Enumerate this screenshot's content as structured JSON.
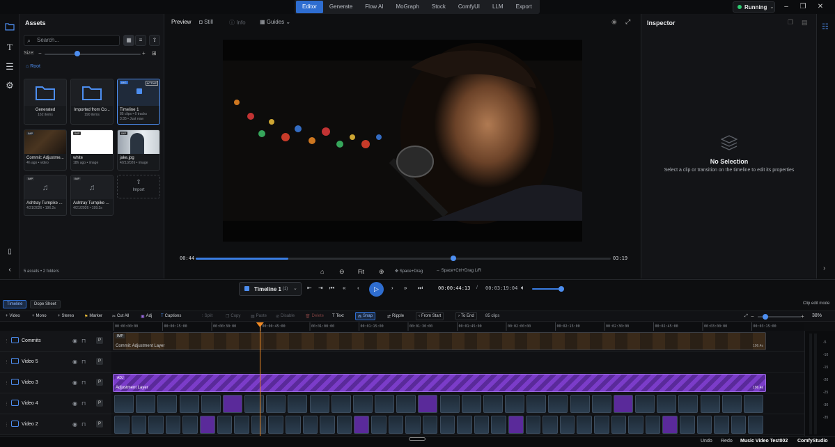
{
  "topbar": {
    "tabs": [
      "Editor",
      "Generate",
      "Flow AI",
      "MoGraph",
      "Stock",
      "ComfyUI",
      "LLM",
      "Export"
    ],
    "active_tab": "Editor",
    "status": "Running"
  },
  "assets": {
    "title": "Assets",
    "search_placeholder": "Search...",
    "size_label": "Size:",
    "breadcrumb": "Root",
    "footer": "5 assets • 2 folders",
    "items": [
      {
        "name": "Generated",
        "meta": "162 items",
        "kind": "folder"
      },
      {
        "name": "Imported from Co...",
        "meta": "190 items",
        "kind": "folder"
      },
      {
        "name": "Timeline 1",
        "meta": "85 clips • 6 tracks",
        "meta2": "3:35 • Just now",
        "kind": "timeline",
        "badge": "IMG",
        "active": "ACTIVE"
      },
      {
        "name": "Commit: Adjustme...",
        "meta": "4h ago • video",
        "kind": "video",
        "badge": "IMP"
      },
      {
        "name": "white",
        "meta": "18h ago • image",
        "kind": "white",
        "badge": "IMP"
      },
      {
        "name": "jake.jpg",
        "meta": "4/21/2026 • image",
        "kind": "photo",
        "badge": "IMP"
      },
      {
        "name": "Ashtray Turnpike ...",
        "meta": "4/21/2026 • 196.2s",
        "kind": "audio",
        "badge": "IMP"
      },
      {
        "name": "Ashtray Turnpike ...",
        "meta": "4/21/2026 • 199.2s",
        "kind": "audio",
        "badge": "IMP"
      }
    ],
    "import_label": "Import"
  },
  "preview": {
    "tabs": [
      "Preview",
      "Still",
      "Info",
      "Guides"
    ],
    "current_time": "00:44",
    "end_time": "03:19",
    "scrub_progress": 0.223,
    "fit_label": "Fit",
    "hint1": "Space+Drag",
    "hint2": "Space+Ctrl+Drag L/R"
  },
  "inspector": {
    "title": "Inspector",
    "empty_title": "No Selection",
    "empty_desc": "Select a clip or transition on the timeline to edit its properties"
  },
  "transport": {
    "timeline_name": "Timeline 1",
    "timeline_count": "(1)",
    "timecode": "00:00:44:13",
    "separator": "/",
    "duration": "00:03:19:04",
    "volume": 0.95
  },
  "timeline": {
    "tabs": [
      "Timeline",
      "Dope Sheet"
    ],
    "mode_label": "Clip edit mode",
    "tools": [
      "Video",
      "Mono",
      "Stereo",
      "Marker",
      "Cut All",
      "Adj",
      "Captions",
      "Split",
      "Copy",
      "Paste",
      "Disable",
      "Delete",
      "Text",
      "Snap",
      "Ripple",
      "From Start",
      "To End"
    ],
    "clip_count": "85 clips",
    "zoom": "38%",
    "ruler_labels": [
      "00:00:00:00",
      "00:00:15:00",
      "00:00:30:00",
      "00:00:45:00",
      "00:01:00:00",
      "00:01:15:00",
      "00:01:30:00",
      "00:01:45:00",
      "00:02:00:00",
      "00:02:15:00",
      "00:02:30:00",
      "00:02:45:00",
      "00:03:00:00",
      "00:03:15:00"
    ],
    "tracks": [
      {
        "name": "Commits",
        "clip_label": "Commit: Adjustment Layer",
        "clip_badge": "IMP",
        "duration": "196.4s"
      },
      {
        "name": "Video 5"
      },
      {
        "name": "Video 3",
        "clip_label": "Adjustment Layer",
        "clip_badge": "ADJ",
        "duration": "196.4s"
      },
      {
        "name": "Video 4"
      },
      {
        "name": "Video 2"
      }
    ],
    "meter_labels": [
      "-5",
      "-10",
      "-15",
      "-20",
      "-25",
      "-30",
      "-35"
    ],
    "playhead_fraction": 0.223
  },
  "status": {
    "undo": "Undo",
    "redo": "Redo",
    "project": "Music Video Test002",
    "app": "ComfyStudio"
  },
  "colors": {
    "accent": "#2e6dd0",
    "playhead": "#f08a24",
    "adjustment": "#7b3cc9",
    "running": "#2ecc71"
  }
}
